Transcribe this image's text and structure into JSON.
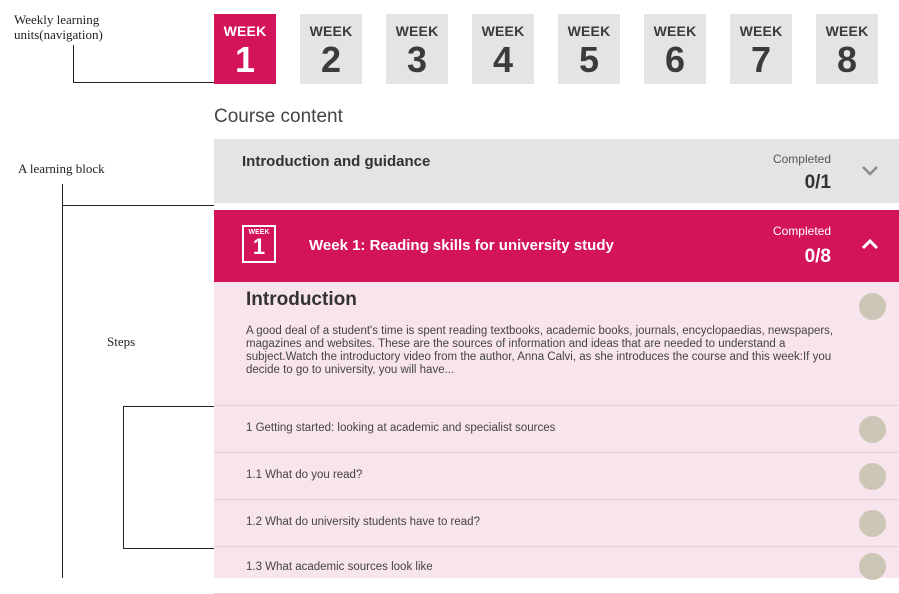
{
  "annotations": {
    "weekly_units": "Weekly learning units(navigation)",
    "learning_block": "A learning block",
    "steps": "Steps"
  },
  "weeks": [
    {
      "label": "WEEK",
      "number": "1",
      "active": true
    },
    {
      "label": "WEEK",
      "number": "2",
      "active": false
    },
    {
      "label": "WEEK",
      "number": "3",
      "active": false
    },
    {
      "label": "WEEK",
      "number": "4",
      "active": false
    },
    {
      "label": "WEEK",
      "number": "5",
      "active": false
    },
    {
      "label": "WEEK",
      "number": "6",
      "active": false
    },
    {
      "label": "WEEK",
      "number": "7",
      "active": false
    },
    {
      "label": "WEEK",
      "number": "8",
      "active": false
    }
  ],
  "course_heading": "Course content",
  "blocks": [
    {
      "title": "Introduction and guidance",
      "completed_label": "Completed",
      "completed_value": "0/1",
      "expanded": false
    },
    {
      "icon_label": "WEEK",
      "icon_number": "1",
      "title": "Week 1: Reading skills for university study",
      "completed_label": "Completed",
      "completed_value": "0/8",
      "expanded": true
    }
  ],
  "intro_step": {
    "heading": "Introduction",
    "text": "A good deal of a student's time is spent reading textbooks, academic books, journals, encyclopaedias, newspapers, magazines and websites. These are the sources of information and ideas that are needed to understand a subject.Watch the introductory video from the author, Anna Calvi, as she introduces the course and this week:If you decide to go to university, you will have..."
  },
  "steps": [
    "1 Getting started: looking at academic and specialist sources",
    "1.1 What do you read?",
    "1.2 What do university students have to read?",
    "1.3 What academic sources look like"
  ],
  "colors": {
    "accent": "#d3135a",
    "tab_inactive": "#e4e4e4",
    "steps_bg": "#f8e4ec",
    "status_circle": "#cbc6b5"
  }
}
